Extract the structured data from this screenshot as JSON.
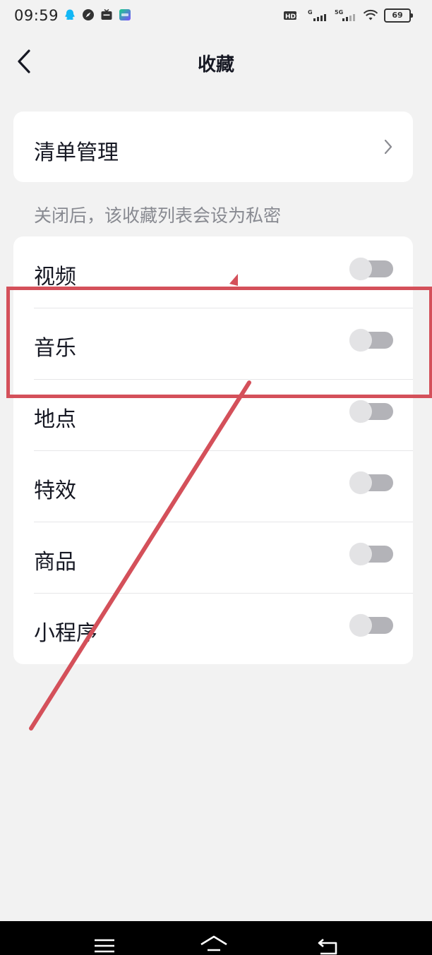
{
  "status_bar": {
    "time": "09:59",
    "battery_level": "69",
    "network_labels": [
      "HD2",
      "G",
      "5G"
    ],
    "icons": [
      "qq-icon",
      "compass-icon",
      "tv-icon",
      "app-icon",
      "hd-icon",
      "signal-icon",
      "signal-5g-icon",
      "wifi-icon",
      "battery-icon"
    ]
  },
  "header": {
    "title": "收藏",
    "back_icon": "chevron-left-icon"
  },
  "list_manage": {
    "label": "清单管理",
    "icon": "chevron-right-icon"
  },
  "privacy_hint": "关闭后，该收藏列表会设为私密",
  "toggles": [
    {
      "label": "视频",
      "on": false
    },
    {
      "label": "音乐",
      "on": false
    },
    {
      "label": "地点",
      "on": false
    },
    {
      "label": "特效",
      "on": false
    },
    {
      "label": "商品",
      "on": false
    },
    {
      "label": "小程序",
      "on": false
    }
  ],
  "annotation": {
    "color": "#d4505a",
    "highlighted_item": "音乐"
  },
  "navigation_bar": {
    "icons": [
      "menu-icon",
      "home-icon",
      "back-icon"
    ]
  },
  "colors": {
    "background": "#f2f2f2",
    "card": "#ffffff",
    "text_primary": "#161823",
    "text_secondary": "#888a91",
    "toggle_track_off": "#b3b3b8",
    "toggle_knob_off": "#e3e3e5"
  }
}
